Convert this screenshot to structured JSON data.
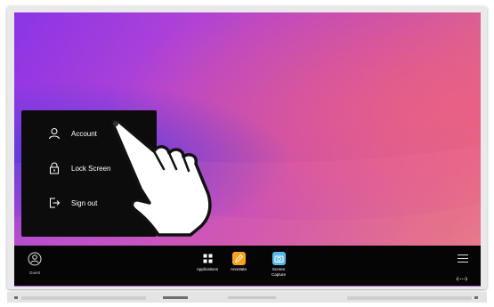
{
  "menu": {
    "items": [
      {
        "label": "Account",
        "icon": "person-icon"
      },
      {
        "label": "Lock Screen",
        "icon": "lock-icon"
      },
      {
        "label": "Sign out",
        "icon": "sign-out-icon"
      }
    ]
  },
  "taskbar": {
    "user_label": "Guest",
    "apps": [
      {
        "label": "Applications",
        "icon": "grid-icon",
        "color": "#000000"
      },
      {
        "label": "Annotate",
        "icon": "pen-icon",
        "color": "#f7a21b"
      },
      {
        "label_line1": "Screen",
        "label_line2": "Capture",
        "icon": "camera-icon",
        "color": "#5ab8e8"
      }
    ],
    "menu_icon": "hamburger-icon",
    "toggle_icon": "swap-arrows-icon"
  },
  "colors": {
    "wallpaper_start": "#8b35e6",
    "wallpaper_end": "#e57a80",
    "menu_bg": "#0c0c0c",
    "taskbar_bg": "#050505"
  }
}
